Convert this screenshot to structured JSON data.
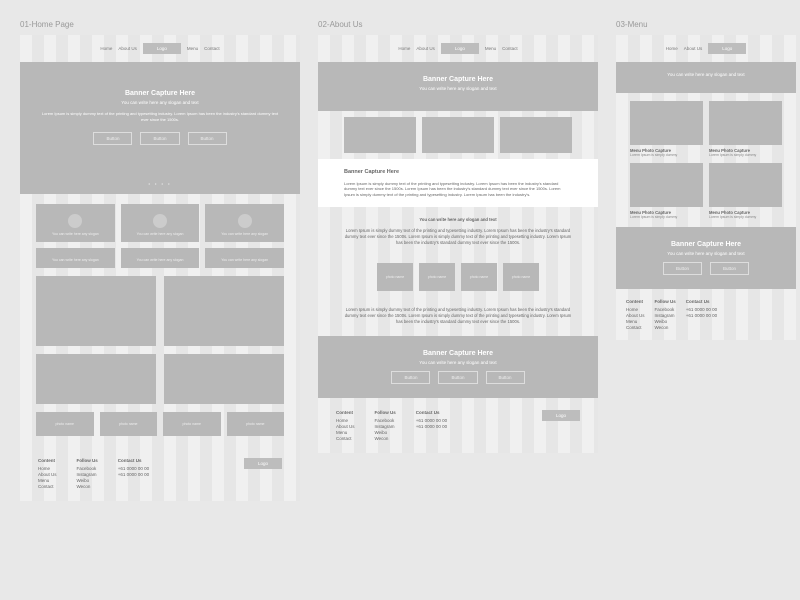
{
  "pages": {
    "home": {
      "label": "01-Home Page"
    },
    "about": {
      "label": "02-About Us"
    },
    "menu": {
      "label": "03-Menu"
    }
  },
  "nav": {
    "home": "Home",
    "about": "About Us",
    "menu": "Menu",
    "contact": "Contact",
    "logo": "Logo"
  },
  "banner": {
    "title": "Banner Capture Here",
    "subtitle": "You can write here any slogan and text",
    "body": "Lorem Ipsum is simply dummy text of the printing and typesetting industry. Lorem Ipsum has been the industry's standard dummy text ever since the 1500s.",
    "button": "Button"
  },
  "card": {
    "text": "You can write here any slogan"
  },
  "thumb": {
    "label": "photo name"
  },
  "about_section": {
    "heading": "Banner Capture Here",
    "para": "Lorem Ipsum is simply dummy text of the printing and typesetting industry. Lorem Ipsum has been the industry's standard dummy text ever since the 1500s. Lorem Ipsum has been the industry's standard dummy text ever since the 1500s. Lorem Ipsum is simply dummy text of the printing and typesetting industry. Lorem Ipsum has been the industry's.",
    "slogan": "You can write here any slogan and text",
    "lorem": "Lorem Ipsum is simply dummy text of the printing and typesetting industry. Lorem Ipsum has been the industry's standard dummy text ever since the 1500s. Lorem Ipsum is simply dummy text of the printing and typesetting industry. Lorem Ipsum has been the industry's standard dummy text ever since the 1500s.",
    "lorem2": "Lorem Ipsum is simply dummy text of the printing and typesetting industry. Lorem Ipsum has been the industry's standard dummy text ever since the 1500s. Lorem Ipsum is simply dummy text of the printing and typesetting industry. Lorem Ipsum has been the industry's standard dummy text ever since the 1500s."
  },
  "menu_section": {
    "caption": "Menu Photo Capture",
    "sub": "Lorem Ipsum is simply dummy"
  },
  "footer": {
    "content_head": "Content",
    "follow_head": "Follow Us",
    "contact_head": "Contact Us",
    "content": {
      "home": "Home",
      "about": "About Us",
      "menu": "Menu",
      "contact": "Contact"
    },
    "follow": {
      "fb": "Facebook",
      "ig": "Instagram",
      "wb": "Weibo",
      "wc": "Wecon"
    },
    "contact": {
      "p1": "+61 0000 00 00",
      "p2": "+61 0000 00 00"
    },
    "logo": "Logo"
  }
}
